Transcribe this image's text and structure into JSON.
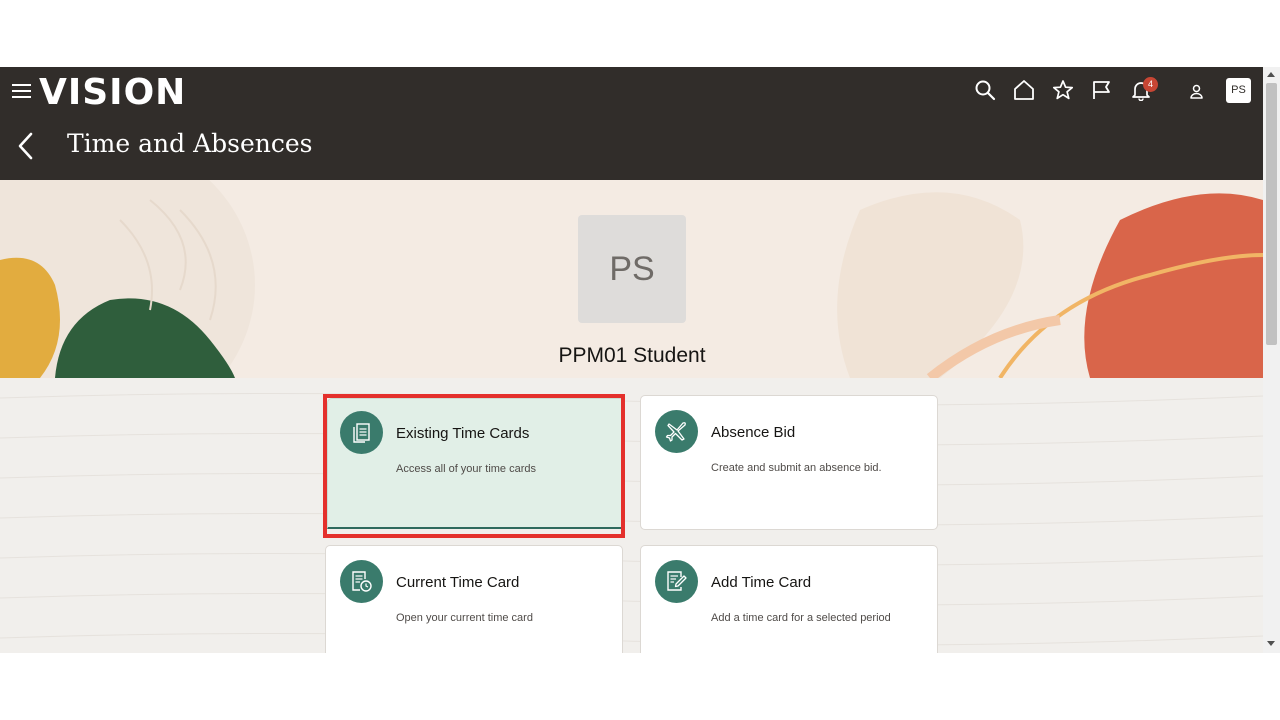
{
  "app": {
    "logo": "VISION",
    "title": "Time and Absences"
  },
  "header": {
    "notification_count": "4",
    "user_initials": "PS"
  },
  "profile": {
    "initials": "PS",
    "name": "PPM01 Student"
  },
  "cards": [
    {
      "title": "Existing Time Cards",
      "description": "Access all of your time cards",
      "icon": "documents-icon"
    },
    {
      "title": "Absence Bid",
      "description": "Create and submit an absence bid.",
      "icon": "airplane-icon"
    },
    {
      "title": "Current Time Card",
      "description": "Open your current time card",
      "icon": "timecard-clock-icon"
    },
    {
      "title": "Add Time Card",
      "description": "Add a time card for a selected period",
      "icon": "document-edit-icon"
    }
  ],
  "colors": {
    "header_bg": "#312d2a",
    "accent": "#3a7b6c",
    "highlight": "#e4302c",
    "badge": "#c74634"
  }
}
